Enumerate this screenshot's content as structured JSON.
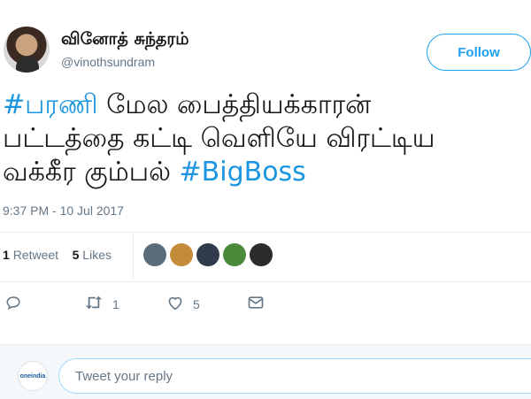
{
  "author": {
    "display_name": "வினோத் சுந்தரம்",
    "handle": "@vinothsundram"
  },
  "follow_label": "Follow",
  "tweet": {
    "hashtag1": "#பரணி",
    "line1_rest": " மேல பைத்தியக்காரன்",
    "line2": "பட்டத்தை கட்டி வெளியே விரட்டிய",
    "line3_start": "வக்கீர கும்பல் ",
    "hashtag2": "#BigBoss"
  },
  "timestamp": "9:37 PM - 10 Jul 2017",
  "stats": {
    "retweet_count": "1",
    "retweet_label": "Retweet",
    "likes_count": "5",
    "likes_label": "Likes"
  },
  "liker_colors": [
    "#5a6c7a",
    "#c48b3b",
    "#2f3a4a",
    "#4a8a3a",
    "#2b2b2b"
  ],
  "actions": {
    "reply_count": "",
    "retweet_count": "1",
    "like_count": "5"
  },
  "reply": {
    "avatar_text": "oneindia",
    "placeholder": "Tweet your reply"
  }
}
